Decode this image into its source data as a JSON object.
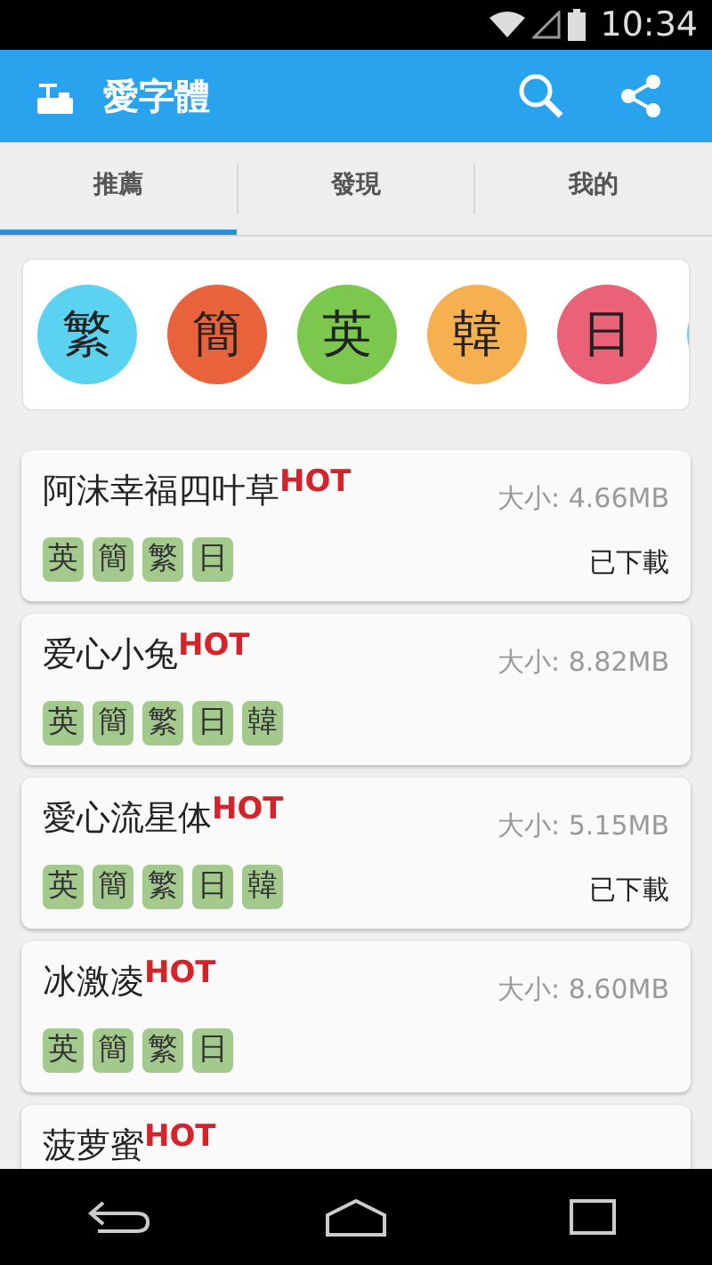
{
  "status_bar": {
    "time": "10:34"
  },
  "app_bar": {
    "title": "愛字體"
  },
  "tabs": [
    {
      "label": "推薦",
      "selected": true
    },
    {
      "label": "發現",
      "selected": false
    },
    {
      "label": "我的",
      "selected": false
    }
  ],
  "languages": [
    {
      "label": "繁",
      "color": "#5bd3f0"
    },
    {
      "label": "簡",
      "color": "#e8623c"
    },
    {
      "label": "英",
      "color": "#7cc84e"
    },
    {
      "label": "韓",
      "color": "#f6b050"
    },
    {
      "label": "日",
      "color": "#ea6277"
    },
    {
      "color": "#5bd3f0"
    }
  ],
  "fonts": [
    {
      "name": "阿沫幸福四叶草",
      "badge": "HOT",
      "size": "大小: 4.66MB",
      "tags": [
        "英",
        "簡",
        "繁",
        "日"
      ],
      "status": "已下載"
    },
    {
      "name": "爱心小兔",
      "badge": "HOT",
      "size": "大小: 8.82MB",
      "tags": [
        "英",
        "簡",
        "繁",
        "日",
        "韓"
      ]
    },
    {
      "name": "愛心流星体",
      "badge": "HOT",
      "size": "大小: 5.15MB",
      "tags": [
        "英",
        "簡",
        "繁",
        "日",
        "韓"
      ],
      "status": "已下載"
    },
    {
      "name": "冰激凌",
      "badge": "HOT",
      "size": "大小: 8.60MB",
      "tags": [
        "英",
        "簡",
        "繁",
        "日"
      ]
    },
    {
      "name": "菠萝蜜",
      "badge": "HOT"
    }
  ]
}
